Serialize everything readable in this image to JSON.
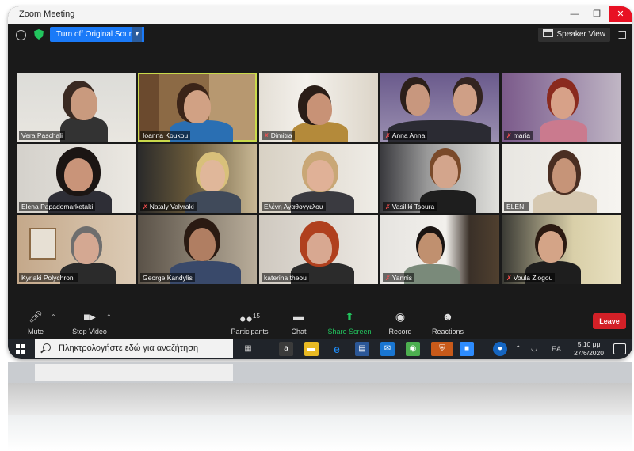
{
  "window": {
    "title": "Zoom Meeting"
  },
  "topbar": {
    "original_sound_label": "Turn off Original Sound",
    "speaker_view_label": "Speaker View"
  },
  "participants": [
    {
      "name": "Vera Paschali",
      "muted": false
    },
    {
      "name": "Ioanna Koukou",
      "muted": false,
      "active": true
    },
    {
      "name": "Dimitra",
      "muted": true
    },
    {
      "name": "Anna Anna",
      "muted": true
    },
    {
      "name": "maria",
      "muted": true
    },
    {
      "name": "Elena Papadomarketaki",
      "muted": false
    },
    {
      "name": "Nataly Valyraki",
      "muted": true
    },
    {
      "name": "Ελένη Αγαθογγέλου",
      "muted": false
    },
    {
      "name": "Vasiliki Tsoura",
      "muted": true
    },
    {
      "name": "ELENI",
      "muted": false
    },
    {
      "name": "Kyriaki Polychroni",
      "muted": false
    },
    {
      "name": "George Kandylis",
      "muted": false
    },
    {
      "name": "katerina theou",
      "muted": false
    },
    {
      "name": "Yannis",
      "muted": true
    },
    {
      "name": "Voula Ziogou",
      "muted": true
    }
  ],
  "toolbar": {
    "mute_label": "Mute",
    "video_label": "Stop Video",
    "participants_label": "Participants",
    "participants_count": "15",
    "chat_label": "Chat",
    "share_label": "Share Screen",
    "record_label": "Record",
    "reactions_label": "Reactions",
    "leave_label": "Leave"
  },
  "taskbar": {
    "search_placeholder": "Πληκτρολογήστε εδώ για αναζήτηση",
    "language": "EA",
    "time": "5:10 μμ",
    "date": "27/6/2020"
  },
  "colors": {
    "accent": "#1a7af8",
    "leave": "#d32027",
    "share": "#22c55e",
    "active_outline": "#c9d94b"
  }
}
